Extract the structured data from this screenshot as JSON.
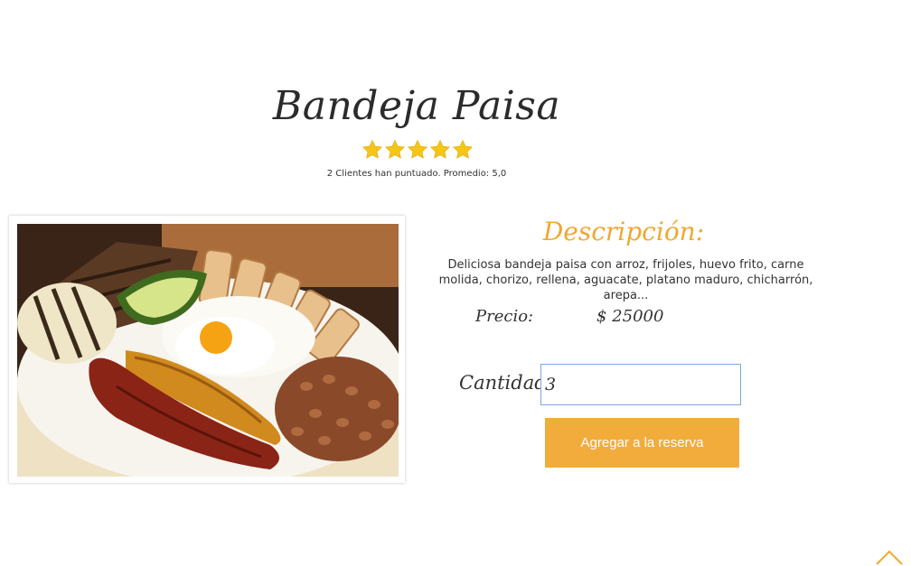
{
  "product": {
    "title": "Bandeja Paisa",
    "rating_stars": 5,
    "rating_text": "2 Clientes han puntuado. Promedio: 5,0",
    "image_alt": "Bandeja Paisa plate"
  },
  "details": {
    "description_title": "Descripción:",
    "description": "Deliciosa bandeja paisa con arroz, frijoles, huevo frito, carne molida, chorizo, rellena, aguacate, platano maduro, chicharrón, arepa...",
    "price_label": "Precio:",
    "price_value": "$ 25000",
    "quantity_label": "Cantidad:",
    "quantity_value": "3",
    "add_button_label": "Agregar a la reserva"
  },
  "colors": {
    "accent": "#f0a830",
    "button": "#f2ac3c",
    "star": "#f5c518"
  },
  "icons": {
    "star": "star-icon",
    "scroll_top": "chevron-up-icon"
  }
}
